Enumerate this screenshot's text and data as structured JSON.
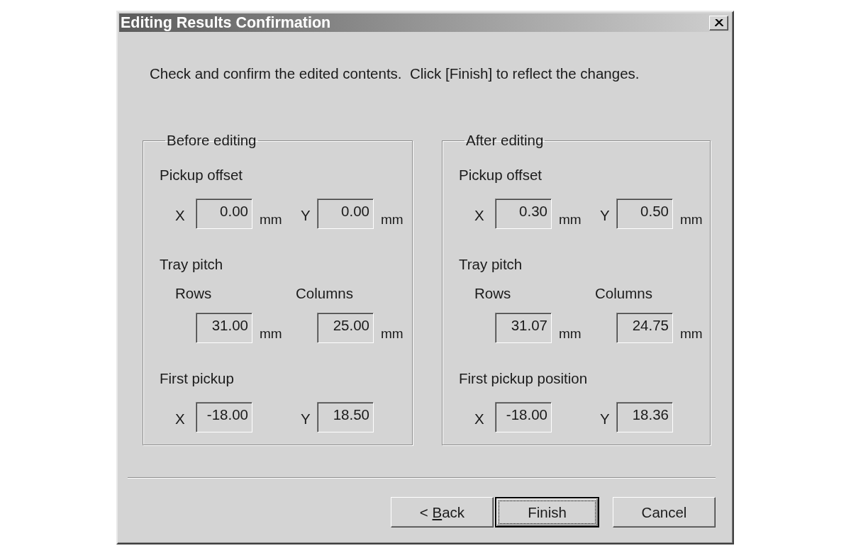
{
  "window": {
    "title": "Editing Results Confirmation"
  },
  "instruction": "Check and confirm the edited contents.  Click [Finish] to reflect the changes.",
  "groups": [
    {
      "title": "Before editing",
      "sections": [
        {
          "kind": "pair",
          "label": "Pickup offset",
          "fields": [
            {
              "axis": "X",
              "value": "0.00",
              "unit": "mm"
            },
            {
              "axis": "Y",
              "value": "0.00",
              "unit": "mm"
            }
          ]
        },
        {
          "kind": "columns",
          "label": "Tray pitch",
          "fields": [
            {
              "caption": "Rows",
              "value": "31.00",
              "unit": "mm"
            },
            {
              "caption": "Columns",
              "value": "25.00",
              "unit": "mm"
            }
          ]
        },
        {
          "kind": "pair",
          "label": "First pickup",
          "fields": [
            {
              "axis": "X",
              "value": "-18.00"
            },
            {
              "axis": "Y",
              "value": "18.50"
            }
          ]
        }
      ]
    },
    {
      "title": "After editing",
      "sections": [
        {
          "kind": "pair",
          "label": "Pickup offset",
          "fields": [
            {
              "axis": "X",
              "value": "0.30",
              "unit": "mm"
            },
            {
              "axis": "Y",
              "value": "0.50",
              "unit": "mm"
            }
          ]
        },
        {
          "kind": "columns",
          "label": "Tray pitch",
          "fields": [
            {
              "caption": "Rows",
              "value": "31.07",
              "unit": "mm"
            },
            {
              "caption": "Columns",
              "value": "24.75",
              "unit": "mm"
            }
          ]
        },
        {
          "kind": "pair",
          "label": "First pickup position",
          "fields": [
            {
              "axis": "X",
              "value": "-18.00"
            },
            {
              "axis": "Y",
              "value": "18.36"
            }
          ]
        }
      ]
    }
  ],
  "buttons": [
    {
      "label_parts": [
        {
          "text": "< ",
          "underlined": false
        },
        {
          "text": "B",
          "underlined": true
        },
        {
          "text": "ack",
          "underlined": false
        }
      ],
      "default": false,
      "focused": false
    },
    {
      "label_parts": [
        {
          "text": "Finish",
          "underlined": false
        }
      ],
      "default": true,
      "focused": true
    },
    {
      "label_parts": [
        {
          "text": "Cancel",
          "underlined": false
        }
      ],
      "default": false,
      "focused": false
    }
  ]
}
